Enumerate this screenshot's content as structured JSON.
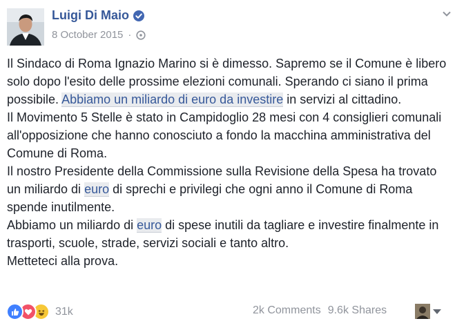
{
  "header": {
    "author_name": "Luigi Di Maio",
    "date": "8 October 2015",
    "separator": "·"
  },
  "icons": {
    "options": "chevron-down-icon",
    "verified": "verified-badge-icon",
    "privacy": "globe-icon",
    "reactions": [
      "like-icon",
      "love-icon",
      "haha-icon"
    ],
    "viewer_menu": "caret-down-icon"
  },
  "post": {
    "p1": {
      "before": "Il Sindaco di Roma Ignazio Marino si è dimesso. Sapremo se il Comune è libero solo dopo l'esito delle prossime elezioni comunali. Sperando ci siano il prima possibile. ",
      "link": "Abbiamo un miliardo di euro da investire",
      "after": " in servizi al cittadino."
    },
    "p2": "Il Movimento 5 Stelle è stato in Campidoglio 28 mesi con 4 consiglieri comunali all'opposizione che hanno conosciuto a fondo la macchina amministrativa del Comune di Roma.",
    "p3": {
      "before": "Il nostro Presidente della Commissione sulla Revisione della Spesa ha trovato un miliardo di ",
      "link": "euro",
      "after": " di sprechi e privilegi che ogni anno il Comune di Roma spende inutilmente."
    },
    "p4": {
      "before": "Abbiamo un miliardo di ",
      "link": "euro",
      "after": " di spese inutili da tagliare e investire finalmente in trasporti, scuole, strade, servizi sociali e tanto altro."
    },
    "p5": "Metteteci alla prova."
  },
  "footer": {
    "reactions_count": "31k",
    "comments": "2k Comments",
    "shares": "9.6k Shares"
  },
  "colors": {
    "link": "#365899",
    "meta": "#90949c",
    "like": "#4080ff",
    "love": "#f25268",
    "haha": "#f7c837"
  }
}
